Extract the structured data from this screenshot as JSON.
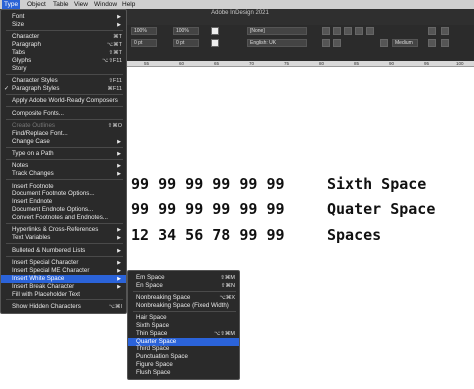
{
  "menubar": {
    "items": [
      {
        "label": "Type",
        "active": true
      },
      {
        "label": "Object"
      },
      {
        "label": "Table"
      },
      {
        "label": "View"
      },
      {
        "label": "Window"
      },
      {
        "label": "Help"
      }
    ]
  },
  "app": {
    "title": "Adobe InDesign 2021",
    "zoom": "100%",
    "pt_field": "0 pt",
    "none_field": "[None]",
    "lang_field": "English: UK",
    "weight_field": "Medium",
    "ruler_ticks": [
      "55",
      "60",
      "65",
      "70",
      "75",
      "80",
      "85",
      "90",
      "95",
      "100"
    ]
  },
  "document": {
    "lines": [
      {
        "text": "99 99 99 99 99 99",
        "label": "Sixth Space"
      },
      {
        "text": "99 99 99 99 99 99",
        "label": "Quater Space"
      },
      {
        "text": "12 34 56 78 99 99",
        "label": "Spaces"
      }
    ]
  },
  "type_menu": {
    "items": [
      {
        "label": "Font",
        "arrow": true
      },
      {
        "label": "Size",
        "arrow": true
      },
      {
        "sep": true
      },
      {
        "label": "Character",
        "shortcut": "⌘T"
      },
      {
        "label": "Paragraph",
        "shortcut": "⌥⌘T"
      },
      {
        "label": "Tabs",
        "shortcut": "⇧⌘T"
      },
      {
        "label": "Glyphs",
        "shortcut": "⌥⇧F11"
      },
      {
        "label": "Story"
      },
      {
        "sep": true
      },
      {
        "label": "Character Styles",
        "shortcut": "⇧F11"
      },
      {
        "label": "Paragraph Styles",
        "shortcut": "⌘F11",
        "checked": true
      },
      {
        "sep": true
      },
      {
        "label": "Apply Adobe World-Ready Composers"
      },
      {
        "sep": true
      },
      {
        "label": "Composite Fonts..."
      },
      {
        "sep": true
      },
      {
        "label": "Create Outlines",
        "shortcut": "⇧⌘O",
        "disabled": true
      },
      {
        "label": "Find/Replace Font..."
      },
      {
        "label": "Change Case",
        "arrow": true
      },
      {
        "sep": true
      },
      {
        "label": "Type on a Path",
        "arrow": true
      },
      {
        "sep": true
      },
      {
        "label": "Notes",
        "arrow": true
      },
      {
        "label": "Track Changes",
        "arrow": true
      },
      {
        "sep": true
      },
      {
        "label": "Insert Footnote"
      },
      {
        "label": "Document Footnote Options..."
      },
      {
        "label": "Insert Endnote"
      },
      {
        "label": "Document Endnote Options..."
      },
      {
        "label": "Convert Footnotes and Endnotes..."
      },
      {
        "sep": true
      },
      {
        "label": "Hyperlinks & Cross-References",
        "arrow": true
      },
      {
        "label": "Text Variables",
        "arrow": true
      },
      {
        "sep": true
      },
      {
        "label": "Bulleted & Numbered Lists",
        "arrow": true
      },
      {
        "sep": true
      },
      {
        "label": "Insert Special Character",
        "arrow": true
      },
      {
        "label": "Insert Special ME Character",
        "arrow": true
      },
      {
        "label": "Insert White Space",
        "arrow": true,
        "highlight": true
      },
      {
        "label": "Insert Break Character",
        "arrow": true
      },
      {
        "label": "Fill with Placeholder Text"
      },
      {
        "sep": true
      },
      {
        "label": "Show Hidden Characters",
        "shortcut": "⌥⌘I"
      }
    ]
  },
  "whitespace_menu": {
    "items": [
      {
        "label": "Em Space",
        "shortcut": "⇧⌘M"
      },
      {
        "label": "En Space",
        "shortcut": "⇧⌘N"
      },
      {
        "sep": true
      },
      {
        "label": "Nonbreaking Space",
        "shortcut": "⌥⌘X"
      },
      {
        "label": "Nonbreaking Space (Fixed Width)"
      },
      {
        "sep": true
      },
      {
        "label": "Hair Space"
      },
      {
        "label": "Sixth Space"
      },
      {
        "label": "Thin Space",
        "shortcut": "⌥⇧⌘M"
      },
      {
        "label": "Quarter Space",
        "highlight": true
      },
      {
        "label": "Third Space"
      },
      {
        "label": "Punctuation Space"
      },
      {
        "label": "Figure Space"
      },
      {
        "label": "Flush Space"
      }
    ]
  },
  "colors": {
    "menu_bg": "#2a2a2a",
    "highlight": "#2b63d9",
    "toolbar_bg": "#2f2f2f"
  }
}
